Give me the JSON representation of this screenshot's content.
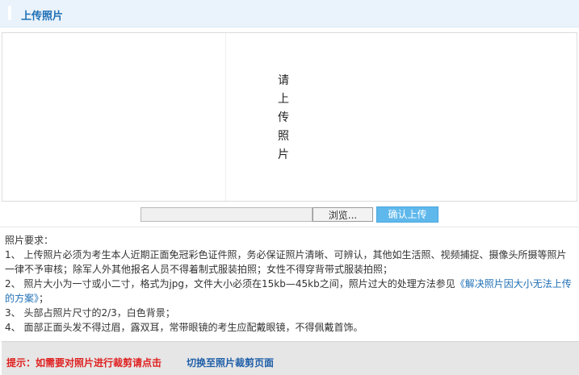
{
  "header": {
    "title": "上传照片"
  },
  "photo_area": {
    "placeholder": "请\n上\n传\n照\n片"
  },
  "upload": {
    "browse_label": "浏览...",
    "confirm_label": "确认上传",
    "file_value": ""
  },
  "requirements": {
    "heading": "照片要求：",
    "item1": "1、 上传照片必须为考生本人近期正面免冠彩色证件照，务必保证照片清晰、可辨认，其他如生活照、视频捕捉、摄像头所摄等照片一律不予审核；除军人外其他报名人员不得着制式服装拍照；女性不得穿背带式服装拍照；",
    "item2_prefix": "2、 照片大小为一寸或小二寸，格式为jpg，文件大小必须在15kb—45kb之间，照片过大的处理方法参见",
    "item2_link": "《解决照片因大小无法上传的方案》",
    "item2_suffix": "；",
    "item3": "3、 头部占照片尺寸的2/3，白色背景；",
    "item4": "4、 面部正面头发不得过眉，露双耳，常带眼镜的考生应配戴眼镜，不得佩戴首饰。"
  },
  "tip": {
    "label": "提示：如需要对照片进行裁剪请点击",
    "link": "切换至照片裁剪页面"
  }
}
